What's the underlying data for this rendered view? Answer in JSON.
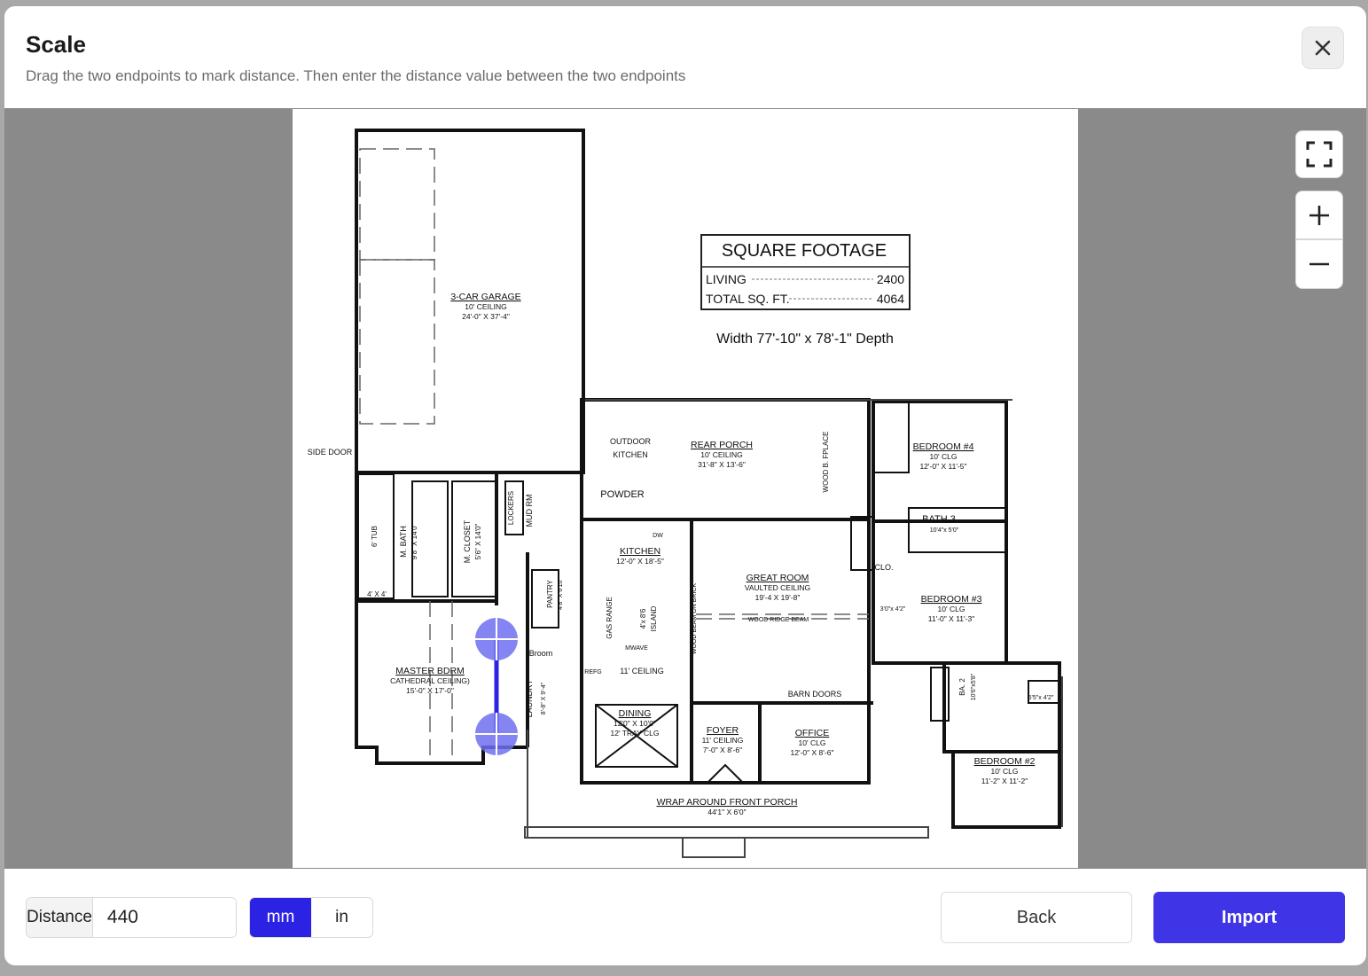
{
  "dialog": {
    "title": "Scale",
    "subtitle": "Drag the two endpoints to mark distance. Then enter the distance value between the two endpoints"
  },
  "plan": {
    "square_footage": {
      "heading": "SQUARE FOOTAGE",
      "rows": [
        {
          "label": "LIVING",
          "value": "2400"
        },
        {
          "label": "TOTAL SQ. FT.",
          "value": "4064"
        }
      ]
    },
    "dimensions": "Width 77'-10\" x 78'-1\" Depth",
    "rooms": [
      {
        "name": "3-CAR GARAGE",
        "detail1": "10' CEILING",
        "detail2": "24'-0\" X 37'-4\""
      },
      {
        "name": "REAR PORCH",
        "detail1": "10' CEILING",
        "detail2": "31'-8\" X 13'-6\""
      },
      {
        "name": "BEDROOM #4",
        "detail1": "10' CLG",
        "detail2": "12'-0\" X 11'-5\""
      },
      {
        "name": "KITCHEN",
        "detail1": "12'-0\" X 18'-5\"",
        "detail2": ""
      },
      {
        "name": "GREAT ROOM",
        "detail1": "VAULTED CEILING",
        "detail2": "19'-4 X 19'-8\""
      },
      {
        "name": "BEDROOM #3",
        "detail1": "10' CLG",
        "detail2": "11'-0\" X 11'-3\""
      },
      {
        "name": "MASTER BDRM",
        "detail1": "CATHEDRAL CEILING)",
        "detail2": "15'-0\" X 17'-0\""
      },
      {
        "name": "DINING",
        "detail1": "12'0\" X 10'0\"",
        "detail2": "12' TRAY CLG"
      },
      {
        "name": "FOYER",
        "detail1": "11' CEILING",
        "detail2": "7'-0\" X 8'-6\""
      },
      {
        "name": "OFFICE",
        "detail1": "10' CLG",
        "detail2": "12'-0\" X 8'-6\""
      },
      {
        "name": "BEDROOM #2",
        "detail1": "10' CLG",
        "detail2": "11'-2\" X 11'-2\""
      },
      {
        "name": "WRAP AROUND FRONT PORCH",
        "detail1": "44'1\" X 6'0\"",
        "detail2": ""
      }
    ],
    "small_labels": {
      "side_door": "SIDE DOOR",
      "outdoor_kitchen_1": "OUTDOOR",
      "outdoor_kitchen_2": "KITCHEN",
      "powder": "POWDER",
      "bath3": "BATH 3",
      "bath3_size": "10'4\"x 5'0\"",
      "clo": "CLO.",
      "barn_doors": "BARN DOORS",
      "ceiling_11": "11' CEILING",
      "wood_ridge": "WOOD RIDGE BEAM",
      "broom": "Broom",
      "mwave": "MWAVE",
      "dw": "DW",
      "refg": "REFG",
      "shower": "4' X 4'",
      "porch_size": "5'5\"x 4'2\"",
      "closet_size": "3'0\"x 4'2\""
    },
    "vertical_labels": {
      "m_bath": "M. BATH",
      "m_bath_size": "9'8\" X 14'0\"",
      "m_closet": "M. CLOSET",
      "m_closet_size": "5'6\" X 14'0\"",
      "lockers": "LOCKERS",
      "mud_rm": "MUD RM",
      "pantry": "PANTRY",
      "pantry_size": "4'8\" X 6'10\"",
      "gas_range": "GAS RANGE",
      "island": "4'x 8'6",
      "island2": "ISLAND",
      "wood_beam": "WOOD BEAM ON BRICK",
      "fplace": "WOOD B. FPLACE",
      "laundry": "LAUNDRY",
      "laundry_size": "8'-8\" X 9'-4\"",
      "tub": "6' TUB",
      "ba2": "BA. 2",
      "ba2_size": "10'6\"x5'8\""
    }
  },
  "scale_markers": {
    "start": "endpoint-1",
    "end": "endpoint-2"
  },
  "footer": {
    "distance_label": "Distance",
    "distance_value": "440",
    "units": [
      "mm",
      "in"
    ],
    "active_unit": "mm",
    "back_label": "Back",
    "import_label": "Import"
  },
  "colors": {
    "primary": "#3f35e6",
    "unit_active": "#2b22e3",
    "marker": "#6f6ff0"
  },
  "icons": {
    "close": "close-icon",
    "fit": "fit-screen-icon",
    "zoom_in": "zoom-in-icon",
    "zoom_out": "zoom-out-icon"
  }
}
